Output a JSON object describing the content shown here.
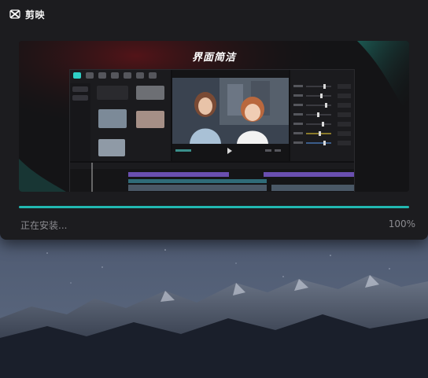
{
  "app": {
    "name": "剪映",
    "logo_icon": "capcut-logo-icon"
  },
  "preview": {
    "title": "界面简洁"
  },
  "install": {
    "status": "正在安装...",
    "percent_label": "100%",
    "progress_fraction": 1.0
  },
  "colors": {
    "accent": "#22b8b1",
    "window_bg": "#1c1c1f",
    "muted_text": "#8b8b90"
  }
}
